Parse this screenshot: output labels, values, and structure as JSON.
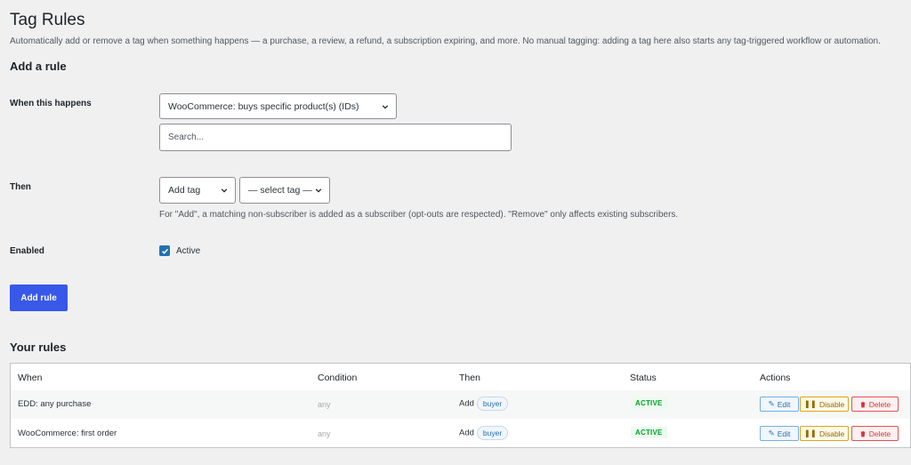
{
  "header": {
    "title": "Tag Rules",
    "description": "Automatically add or remove a tag when something happens — a purchase, a review, a refund, a subscription expiring, and more. No manual tagging: adding a tag here also starts any tag-triggered workflow or automation."
  },
  "add_rule": {
    "heading": "Add a rule",
    "when_label": "When this happens",
    "trigger_value": "WooCommerce: buys specific product(s) (IDs)",
    "search_placeholder": "Search...",
    "then_label": "Then",
    "action_value": "Add tag",
    "tag_value": "— select tag —",
    "hint": "For \"Add\", a matching non-subscriber is added as a subscriber (opt-outs are respected). \"Remove\" only affects existing subscribers.",
    "enabled_label": "Enabled",
    "active_label": "Active",
    "active_checked": true,
    "submit_label": "Add rule"
  },
  "rules": {
    "heading": "Your rules",
    "columns": [
      "When",
      "Condition",
      "Then",
      "Status",
      "Actions"
    ],
    "rows": [
      {
        "when": "EDD: any purchase",
        "condition": "any",
        "then_action": "Add",
        "tag": "buyer",
        "status": "ACTIVE"
      },
      {
        "when": "WooCommerce: first order",
        "condition": "any",
        "then_action": "Add",
        "tag": "buyer",
        "status": "ACTIVE"
      }
    ],
    "action_labels": {
      "edit": "Edit",
      "disable": "Disable",
      "delete": "Delete"
    }
  },
  "colors": {
    "accent": "#3858e9",
    "status_active": "#00a32a",
    "edit": "#2271b1",
    "disable": "#996800",
    "delete": "#d63638"
  }
}
